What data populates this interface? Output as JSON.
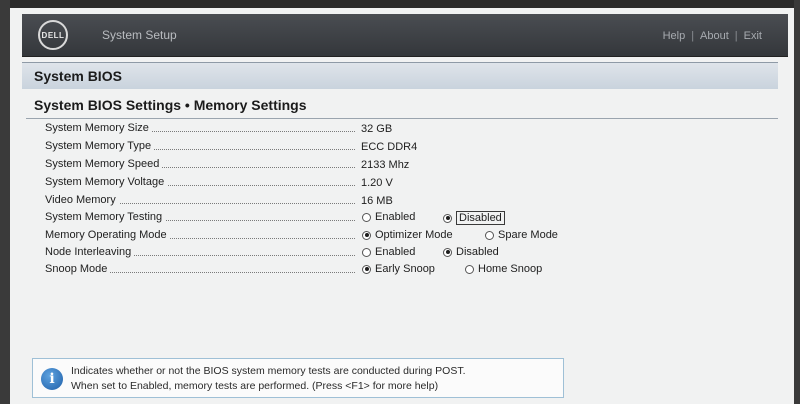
{
  "header": {
    "logo_text": "DELL",
    "title": "System Setup",
    "links": [
      "Help",
      "About",
      "Exit"
    ],
    "separator": "|"
  },
  "section_title": "System BIOS",
  "page_title": "System BIOS Settings • Memory Settings",
  "settings": [
    {
      "label": "System Memory Size",
      "value": "32 GB"
    },
    {
      "label": "System Memory Type",
      "value": "ECC DDR4"
    },
    {
      "label": "System Memory Speed",
      "value": "2133 Mhz"
    },
    {
      "label": "System Memory Voltage",
      "value": "1.20 V"
    },
    {
      "label": "Video Memory",
      "value": "16 MB"
    },
    {
      "label": "System Memory Testing",
      "options": [
        {
          "label": "Enabled",
          "selected": false
        },
        {
          "label": "Disabled",
          "selected": true,
          "focused": true
        }
      ]
    },
    {
      "label": "Memory Operating Mode",
      "options": [
        {
          "label": "Optimizer Mode",
          "selected": true
        },
        {
          "label": "Spare Mode",
          "selected": false
        }
      ]
    },
    {
      "label": "Node Interleaving",
      "options": [
        {
          "label": "Enabled",
          "selected": false
        },
        {
          "label": "Disabled",
          "selected": true
        }
      ]
    },
    {
      "label": "Snoop Mode",
      "options": [
        {
          "label": "Early Snoop",
          "selected": true
        },
        {
          "label": "Home Snoop",
          "selected": false
        }
      ]
    }
  ],
  "help": {
    "icon": "info-icon",
    "line1": "Indicates whether or not the BIOS system memory tests are conducted during POST.",
    "line2": "When set to Enabled, memory tests are performed. (Press <F1> for more help)"
  }
}
